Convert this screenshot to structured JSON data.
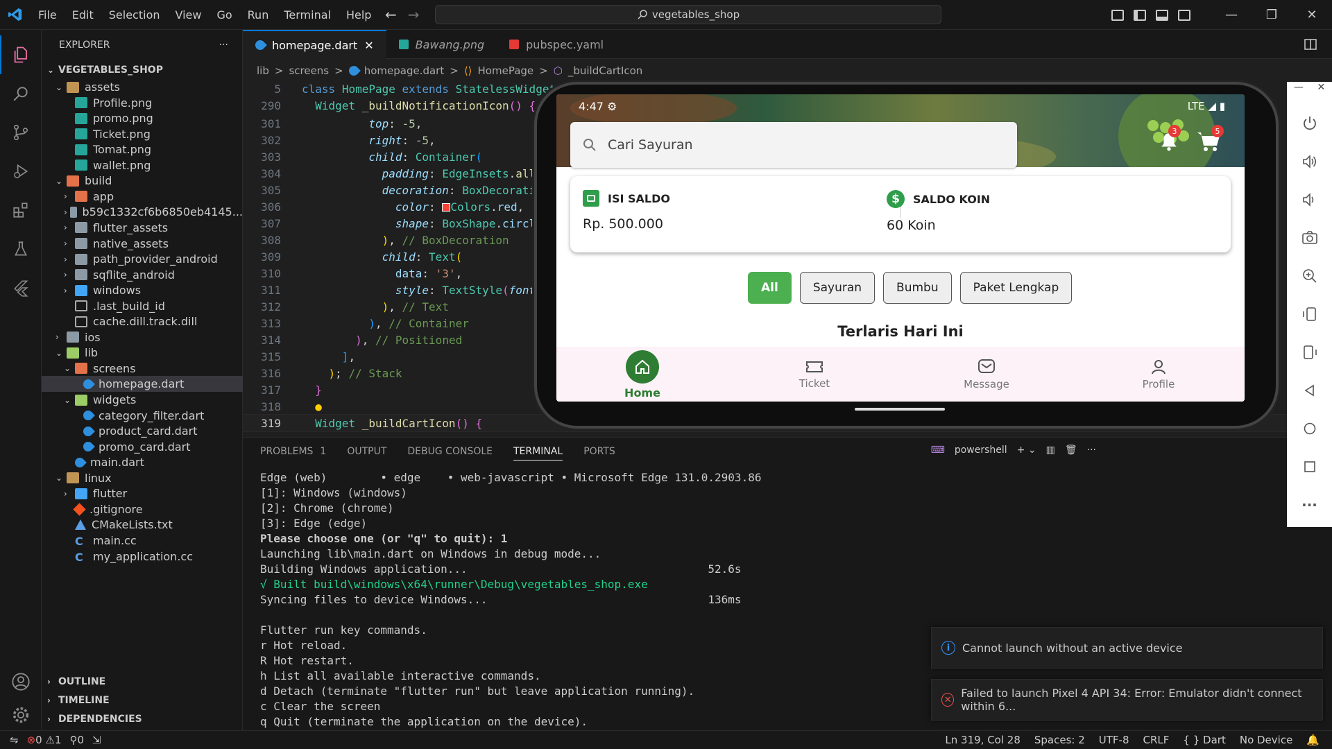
{
  "titlebar": {
    "menu": [
      "File",
      "Edit",
      "Selection",
      "View",
      "Go",
      "Run",
      "Terminal",
      "Help"
    ],
    "search": "vegetables_shop"
  },
  "explorer": {
    "header": "EXPLORER",
    "more": "···",
    "root": "VEGETABLES_SHOP",
    "items": [
      {
        "label": "assets",
        "depth": 1,
        "kind": "folder",
        "open": true
      },
      {
        "label": "Profile.png",
        "depth": 2,
        "kind": "image"
      },
      {
        "label": "promo.png",
        "depth": 2,
        "kind": "image"
      },
      {
        "label": "Ticket.png",
        "depth": 2,
        "kind": "image"
      },
      {
        "label": "Tomat.png",
        "depth": 2,
        "kind": "image"
      },
      {
        "label": "wallet.png",
        "depth": 2,
        "kind": "image"
      },
      {
        "label": "build",
        "depth": 1,
        "kind": "folder-red",
        "open": true
      },
      {
        "label": "app",
        "depth": 2,
        "kind": "folder-red",
        "open": false
      },
      {
        "label": "b59c1332cf6b6850eb4145...",
        "depth": 2,
        "kind": "folder-grey",
        "open": false
      },
      {
        "label": "flutter_assets",
        "depth": 2,
        "kind": "folder-grey",
        "open": false
      },
      {
        "label": "native_assets",
        "depth": 2,
        "kind": "folder-grey",
        "open": false
      },
      {
        "label": "path_provider_android",
        "depth": 2,
        "kind": "folder-grey",
        "open": false
      },
      {
        "label": "sqflite_android",
        "depth": 2,
        "kind": "folder-grey",
        "open": false
      },
      {
        "label": "windows",
        "depth": 2,
        "kind": "folder-blue",
        "open": false
      },
      {
        "label": ".last_build_id",
        "depth": 2,
        "kind": "file"
      },
      {
        "label": "cache.dill.track.dill",
        "depth": 2,
        "kind": "file"
      },
      {
        "label": "ios",
        "depth": 1,
        "kind": "folder-grey",
        "open": false
      },
      {
        "label": "lib",
        "depth": 1,
        "kind": "folder-green",
        "open": true
      },
      {
        "label": "screens",
        "depth": 2,
        "kind": "folder-red",
        "open": true
      },
      {
        "label": "homepage.dart",
        "depth": 3,
        "kind": "dart",
        "selected": true
      },
      {
        "label": "widgets",
        "depth": 2,
        "kind": "folder-green",
        "open": true
      },
      {
        "label": "category_filter.dart",
        "depth": 3,
        "kind": "dart"
      },
      {
        "label": "product_card.dart",
        "depth": 3,
        "kind": "dart"
      },
      {
        "label": "promo_card.dart",
        "depth": 3,
        "kind": "dart"
      },
      {
        "label": "main.dart",
        "depth": 2,
        "kind": "dart"
      },
      {
        "label": "linux",
        "depth": 1,
        "kind": "folder",
        "open": true
      },
      {
        "label": "flutter",
        "depth": 2,
        "kind": "folder-blue",
        "open": false
      },
      {
        "label": ".gitignore",
        "depth": 2,
        "kind": "git"
      },
      {
        "label": "CMakeLists.txt",
        "depth": 2,
        "kind": "cmake"
      },
      {
        "label": "main.cc",
        "depth": 2,
        "kind": "cc"
      },
      {
        "label": "my_application.cc",
        "depth": 2,
        "kind": "cc"
      }
    ],
    "sections": [
      "OUTLINE",
      "TIMELINE",
      "DEPENDENCIES"
    ]
  },
  "tabs": [
    {
      "label": "homepage.dart",
      "active": true,
      "close": "✕"
    },
    {
      "label": "Bawang.png",
      "active": false
    },
    {
      "label": "pubspec.yaml",
      "active": false
    }
  ],
  "breadcrumb": [
    "lib",
    "screens",
    "homepage.dart",
    "HomePage",
    "_buildCartIcon"
  ],
  "breadcrumb_sep": ">",
  "code": {
    "l5": "5",
    "l290": "290",
    "l301": "301",
    "l302": "302",
    "l303": "303",
    "l304": "304",
    "l305": "305",
    "l306": "306",
    "l307": "307",
    "l308": "308",
    "l309": "309",
    "l310": "310",
    "l311": "311",
    "l312": "312",
    "l313": "313",
    "l314": "314",
    "l315": "315",
    "l316": "316",
    "l317": "317",
    "l318": "318",
    "l319": "319"
  },
  "panel": {
    "tabs": [
      "PROBLEMS",
      "OUTPUT",
      "DEBUG CONSOLE",
      "TERMINAL",
      "PORTS"
    ],
    "problems_count": "1",
    "shell": "powershell",
    "terminal_lines": [
      "Edge (web)        • edge    • web-javascript • Microsoft Edge 131.0.2903.86",
      "[1]: Windows (windows)",
      "[2]: Chrome (chrome)",
      "[3]: Edge (edge)",
      "Please choose one (or \"q\" to quit): 1",
      "Launching lib\\main.dart on Windows in debug mode...",
      "Building Windows application...                                    52.6s",
      "√ Built build\\windows\\x64\\runner\\Debug\\vegetables_shop.exe",
      "Syncing files to device Windows...                                 136ms",
      "",
      "Flutter run key commands.",
      "r Hot reload.",
      "R Hot restart.",
      "h List all available interactive commands.",
      "d Detach (terminate \"flutter run\" but leave application running).",
      "c Clear the screen",
      "q Quit (terminate the application on the device)."
    ]
  },
  "notifications": [
    {
      "text": "Cannot launch without an active device",
      "type": "info"
    },
    {
      "text": "Failed to launch Pixel 4 API 34: Error: Emulator didn't connect within 6...",
      "type": "error"
    }
  ],
  "statusbar": {
    "errors": "0",
    "warnings": "1",
    "ports": "0",
    "position": "Ln 319, Col 28",
    "spaces": "Spaces: 2",
    "encoding": "UTF-8",
    "eol": "CRLF",
    "language": "Dart",
    "device": "No Device"
  },
  "app": {
    "time": "4:47",
    "network": "LTE",
    "search_placeholder": "Cari Sayuran",
    "notif_count": "3",
    "cart_count": "5",
    "isi_saldo_label": "ISI SALDO",
    "isi_saldo_value": "Rp. 500.000",
    "koin_label": "SALDO KOIN",
    "koin_value": "60 Koin",
    "chips": [
      "All",
      "Sayuran",
      "Bumbu",
      "Paket Lengkap"
    ],
    "section_title": "Terlaris Hari Ini",
    "nav": [
      "Home",
      "Ticket",
      "Message",
      "Profile"
    ],
    "accent": "#2e7d32"
  }
}
